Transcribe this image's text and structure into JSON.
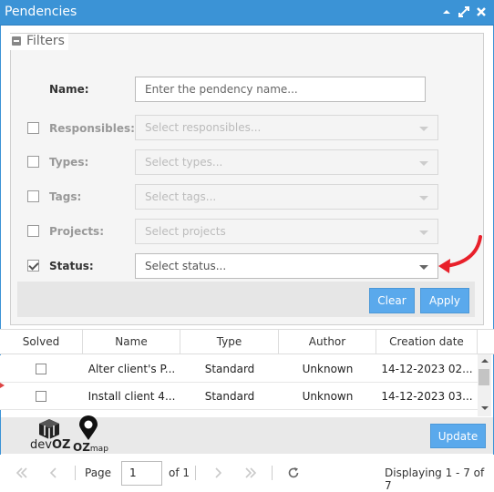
{
  "window": {
    "title": "Pendencies"
  },
  "filters": {
    "legend": "Filters",
    "name": {
      "label": "Name:",
      "placeholder": "Enter the pendency name..."
    },
    "responsibles": {
      "label": "Responsibles:",
      "placeholder": "Select responsibles..."
    },
    "types": {
      "label": "Types:",
      "placeholder": "Select types..."
    },
    "tags": {
      "label": "Tags:",
      "placeholder": "Select tags..."
    },
    "projects": {
      "label": "Projects:",
      "placeholder": "Select projects"
    },
    "status": {
      "label": "Status:",
      "placeholder": "Select status..."
    },
    "clear_label": "Clear",
    "apply_label": "Apply"
  },
  "grid": {
    "columns": [
      "Solved",
      "Name",
      "Type",
      "Author",
      "Creation date"
    ],
    "rows": [
      {
        "name": "Alter client's P...",
        "type": "Standard",
        "author": "Unknown",
        "date": "14-12-2023 02..."
      },
      {
        "name": "Install client 4...",
        "type": "Standard",
        "author": "Unknown",
        "date": "14-12-2023 03..."
      }
    ]
  },
  "footer": {
    "logo1": {
      "prefix": "dev",
      "suffix": "OZ"
    },
    "logo2": {
      "prefix": "OZ",
      "suffix": "map"
    },
    "update_label": "Update"
  },
  "pager": {
    "page_label": "Page",
    "page_value": "1",
    "of_label": "of 1",
    "display": "Displaying 1 - 7 of 7"
  },
  "colors": {
    "titlebar": "#3b93d6",
    "button": "#5aa9ec",
    "annotation": "#e8202a"
  }
}
